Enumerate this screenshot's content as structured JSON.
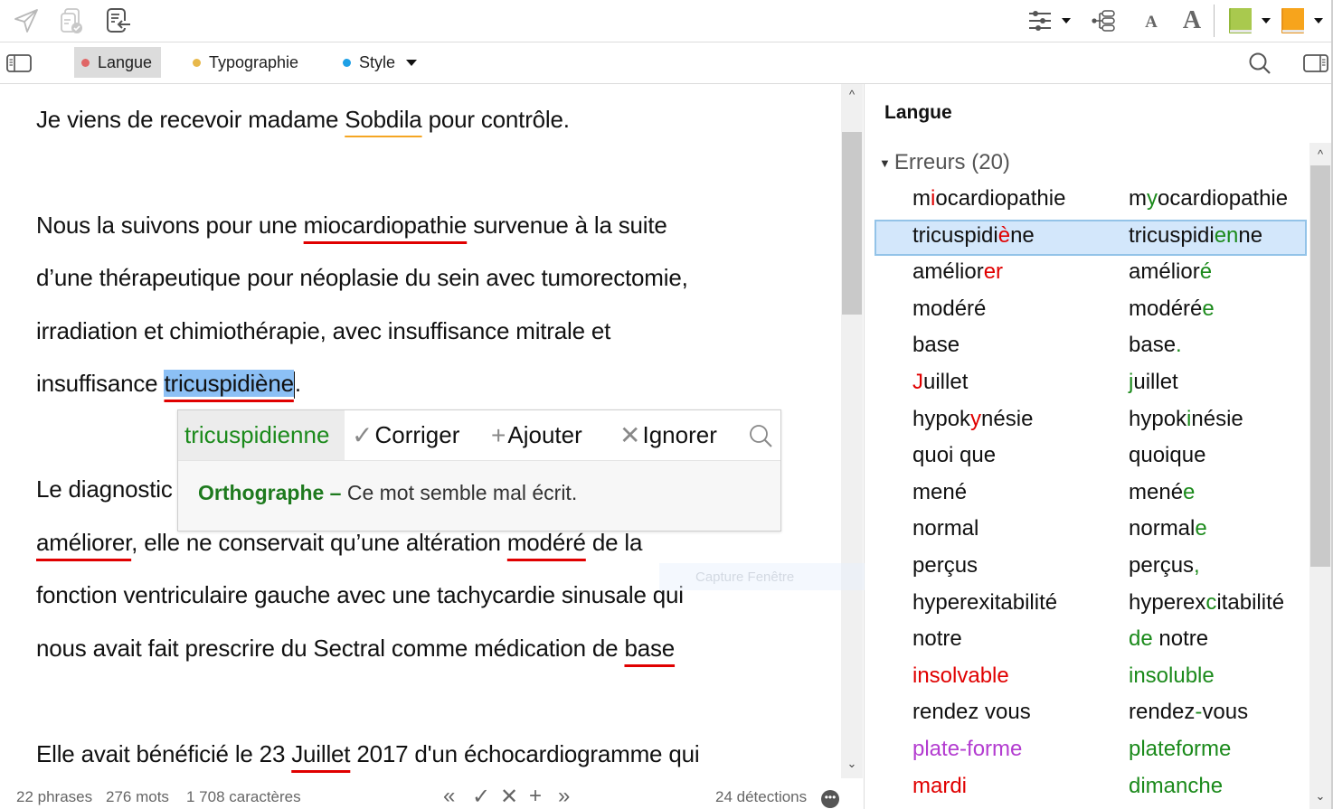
{
  "toolbar": {
    "left_icons": [
      "send-icon",
      "copy-check-icon",
      "import-document-icon"
    ],
    "right_icons": [
      "settings-sliders-icon",
      "tree-structure-icon",
      "font-decrease-icon",
      "font-increase-icon",
      "green-book-icon",
      "orange-book-icon"
    ],
    "font_small_label": "A",
    "font_large_label": "A"
  },
  "filters": {
    "tabs": [
      {
        "label": "Langue",
        "dot_color": "#e06666",
        "active": true
      },
      {
        "label": "Typographie",
        "dot_color": "#e8b84a",
        "active": false
      },
      {
        "label": "Style",
        "dot_color": "#1ea0e6",
        "active": false
      }
    ]
  },
  "editor": {
    "lines": [
      {
        "before": "Je viens de recevoir madame ",
        "flag": "Sobdila",
        "after": " pour contrôle."
      },
      {
        "before": "Nous la suivons pour une ",
        "flag": "miocardiopathie",
        "after": " survenue à la suite"
      },
      {
        "text": "d’une thérapeutique pour néoplasie du sein avec tumorectomie,"
      },
      {
        "text": "irradiation et chimiothérapie, avec insuffisance mitrale et"
      },
      {
        "before": "insuffisance ",
        "flag": "tricuspidiène",
        "after": "."
      },
      {
        "text": "Le diagnostic"
      },
      {
        "flag": "améliorer",
        "mid": ", elle ne conservait qu’une altération ",
        "flag2": "modéré",
        "after": " de la"
      },
      {
        "text": "fonction ventriculaire gauche avec une tachycardie sinusale qui"
      },
      {
        "before": "nous avait fait prescrire du Sectral comme médication de ",
        "flag": "base"
      },
      {
        "before": "Elle avait bénéficié le 23 ",
        "flag": "Juillet",
        "after": " 2017 d'un échocardiogramme qui"
      }
    ]
  },
  "popup": {
    "suggestion": "tricuspidienne",
    "correct_label": "Corriger",
    "add_label": "Ajouter",
    "ignore_label": "Ignorer",
    "category": "Orthographe –",
    "message": "Ce mot semble mal écrit."
  },
  "ghost_label": "Capture Fenêtre",
  "status": {
    "phrases": "22 phrases",
    "mots": "276 mots",
    "caracteres": "1 708 caractères",
    "detections": "24 détections",
    "nav": {
      "prev": "«",
      "accept": "✓",
      "reject": "✕",
      "add": "+",
      "next": "»"
    }
  },
  "panel": {
    "title": "Langue",
    "group_label": "Erreurs (20)",
    "colors": {
      "error": "#e00000",
      "fix": "#1b8a1b",
      "style": "#b33cd0"
    },
    "rows": [
      {
        "orig": [
          [
            "m",
            ""
          ],
          [
            "i",
            "r"
          ],
          [
            "ocardiopathie",
            ""
          ]
        ],
        "fix": [
          [
            "m",
            ""
          ],
          [
            "y",
            "g"
          ],
          [
            "ocardiopathie",
            ""
          ]
        ]
      },
      {
        "orig": [
          [
            "tricuspidi",
            ""
          ],
          [
            "è",
            "r"
          ],
          [
            "ne",
            ""
          ]
        ],
        "fix": [
          [
            "tricuspidi",
            ""
          ],
          [
            "en",
            "g"
          ],
          [
            "ne",
            ""
          ]
        ],
        "selected": true
      },
      {
        "orig": [
          [
            "amélior",
            ""
          ],
          [
            "er",
            "r"
          ]
        ],
        "fix": [
          [
            "amélior",
            ""
          ],
          [
            "é",
            "g"
          ]
        ]
      },
      {
        "orig": [
          [
            "modéré",
            ""
          ]
        ],
        "fix": [
          [
            "modéré",
            ""
          ],
          [
            "e",
            "g"
          ]
        ]
      },
      {
        "orig": [
          [
            "base",
            ""
          ]
        ],
        "fix": [
          [
            "base",
            ""
          ],
          [
            ".",
            "g"
          ]
        ]
      },
      {
        "orig": [
          [
            "J",
            "r"
          ],
          [
            "uillet",
            ""
          ]
        ],
        "fix": [
          [
            "j",
            "g"
          ],
          [
            "uillet",
            ""
          ]
        ]
      },
      {
        "orig": [
          [
            "hypok",
            ""
          ],
          [
            "y",
            "r"
          ],
          [
            "nésie",
            ""
          ]
        ],
        "fix": [
          [
            "hypok",
            ""
          ],
          [
            "i",
            "g"
          ],
          [
            "nésie",
            ""
          ]
        ]
      },
      {
        "orig": [
          [
            "quoi que",
            ""
          ]
        ],
        "fix": [
          [
            "quoique",
            ""
          ]
        ]
      },
      {
        "orig": [
          [
            "mené",
            ""
          ]
        ],
        "fix": [
          [
            "mené",
            ""
          ],
          [
            "e",
            "g"
          ]
        ]
      },
      {
        "orig": [
          [
            "normal",
            ""
          ]
        ],
        "fix": [
          [
            "normal",
            ""
          ],
          [
            "e",
            "g"
          ]
        ]
      },
      {
        "orig": [
          [
            "perçus",
            ""
          ]
        ],
        "fix": [
          [
            "perçus",
            ""
          ],
          [
            ",",
            "g"
          ]
        ]
      },
      {
        "orig": [
          [
            "hyperexitabilité",
            ""
          ]
        ],
        "fix": [
          [
            "hyperex",
            ""
          ],
          [
            "c",
            "g"
          ],
          [
            "itabilité",
            ""
          ]
        ]
      },
      {
        "orig": [
          [
            "notre",
            ""
          ]
        ],
        "fix": [
          [
            "de",
            "g"
          ],
          [
            " notre",
            ""
          ]
        ]
      },
      {
        "orig": [
          [
            "insolvable",
            "r"
          ]
        ],
        "fix": [
          [
            "insoluble",
            "g"
          ]
        ]
      },
      {
        "orig": [
          [
            "rendez vous",
            ""
          ]
        ],
        "fix": [
          [
            "rendez",
            ""
          ],
          [
            "-",
            "g"
          ],
          [
            "vous",
            ""
          ]
        ]
      },
      {
        "orig": [
          [
            "plate-forme",
            "p"
          ]
        ],
        "fix": [
          [
            "plateforme",
            "g"
          ]
        ]
      },
      {
        "orig": [
          [
            "mardi",
            "r"
          ]
        ],
        "fix": [
          [
            "dimanche",
            "g"
          ]
        ]
      }
    ]
  }
}
